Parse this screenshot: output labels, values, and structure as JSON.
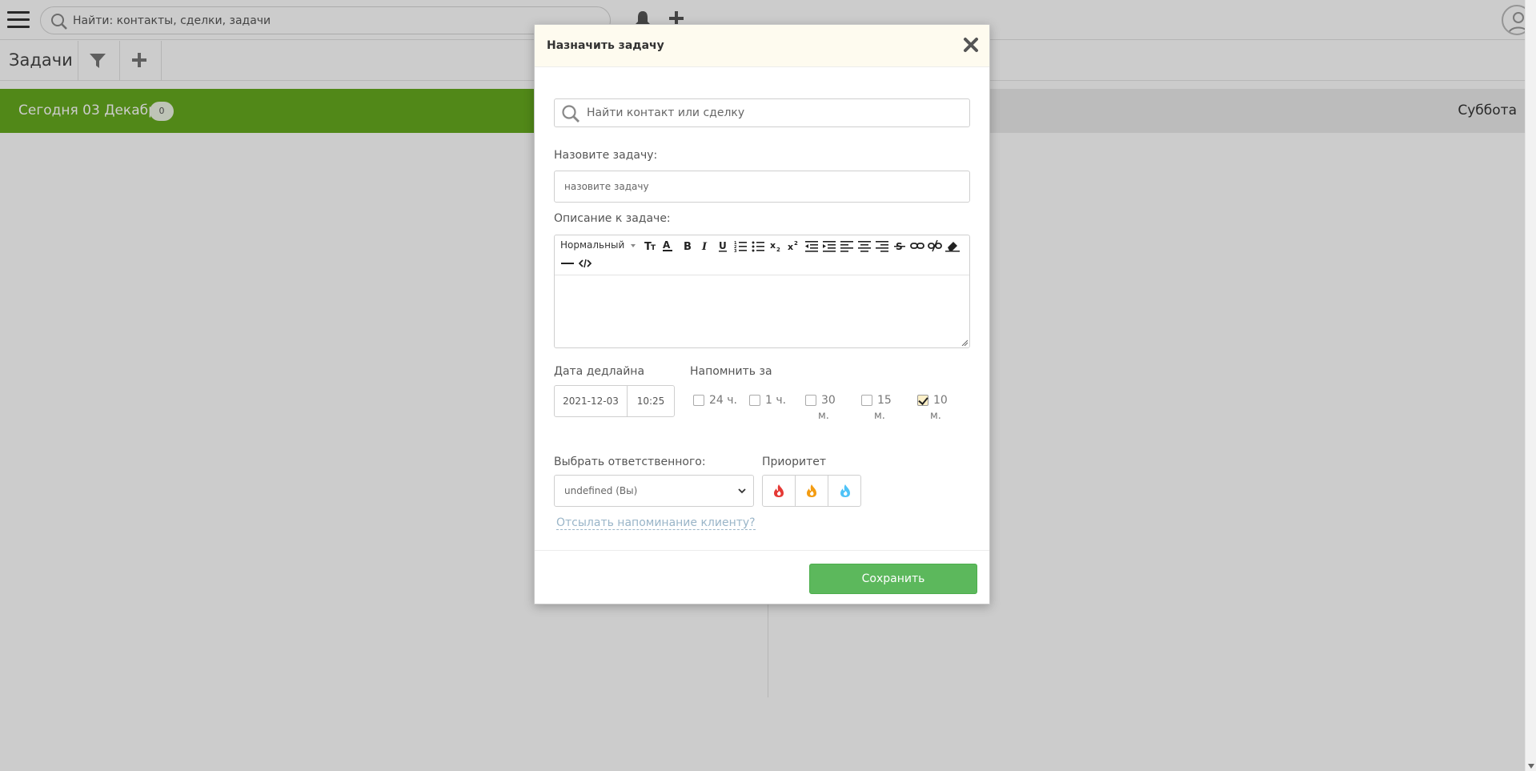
{
  "topbar": {
    "search_placeholder": "Найти: контакты, сделки, задачи"
  },
  "subbar": {
    "title": "Задачи"
  },
  "calendar": {
    "today_label": "Сегодня 03 Декабря",
    "today_count": "0",
    "next_day": "Суббота"
  },
  "modal": {
    "title": "Назначить задачу",
    "contact_search_placeholder": "Найти контакт или сделку",
    "task_name_label": "Назовите задачу:",
    "task_name_placeholder": "назовите задачу",
    "description_label": "Описание к задаче:",
    "editor_style": "Нормальный",
    "deadline_label": "Дата дедлайна",
    "deadline_date": "2021-12-03",
    "deadline_time": "10:25",
    "remind_label": "Напомнить за",
    "remind_options": [
      {
        "line1": "24 ч.",
        "line2": "",
        "checked": false
      },
      {
        "line1": "1 ч.",
        "line2": "",
        "checked": false
      },
      {
        "line1": "30",
        "line2": "м.",
        "checked": false
      },
      {
        "line1": "15",
        "line2": "м.",
        "checked": false
      },
      {
        "line1": "10",
        "line2": "м.",
        "checked": true
      }
    ],
    "responsible_label": "Выбрать ответственного:",
    "responsible_value": "undefined (Вы)",
    "priority_label": "Приоритет",
    "priority_colors": [
      "#e53935",
      "#f39c12",
      "#4fc3f7"
    ],
    "remind_client_link": "Отсылать напоминание клиенту?",
    "save_label": "Сохранить"
  },
  "colors": {
    "accent_green": "#66aa1f",
    "save_green": "#5cb85c",
    "modal_header": "#fefbef"
  }
}
